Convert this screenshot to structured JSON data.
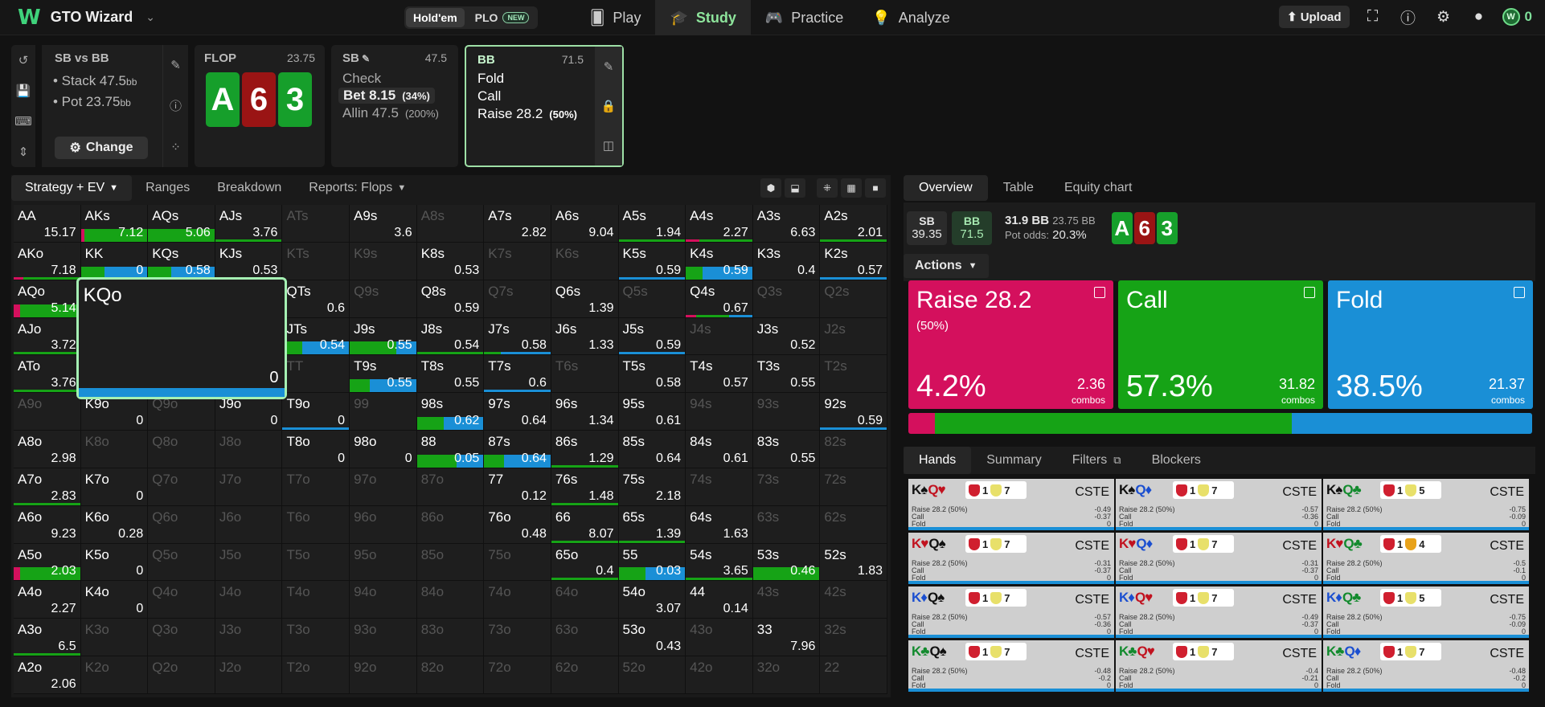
{
  "topbar": {
    "brand_mark": "W",
    "app_title": "GTO Wizard",
    "variants": [
      "Hold'em",
      "PLO"
    ],
    "new_badge": "NEW",
    "nav": [
      {
        "label": "Play",
        "icon": "cards-icon"
      },
      {
        "label": "Study",
        "icon": "graduation-cap-icon"
      },
      {
        "label": "Practice",
        "icon": "gamepad-icon"
      },
      {
        "label": "Analyze",
        "icon": "bulb-icon"
      }
    ],
    "upload_label": "Upload",
    "credits": "0"
  },
  "spot": {
    "title": "SB vs BB",
    "stack_label": "• Stack 47.5",
    "pot_label": "• Pot 23.75",
    "unit": "bb",
    "change_label": "Change"
  },
  "flop": {
    "label": "FLOP",
    "pot": "23.75",
    "cards": [
      {
        "rank": "A",
        "suit": "club"
      },
      {
        "rank": "6",
        "suit": "heart"
      },
      {
        "rank": "3",
        "suit": "club"
      }
    ]
  },
  "sb_node": {
    "label": "SB",
    "stack": "47.5",
    "options": [
      {
        "name": "Check",
        "pct": ""
      },
      {
        "name": "Bet 8.15",
        "pct": "(34%)"
      },
      {
        "name": "Allin 47.5",
        "pct": "(200%)"
      }
    ]
  },
  "bb_node": {
    "label": "BB",
    "stack": "71.5",
    "options": [
      {
        "name": "Fold",
        "pct": ""
      },
      {
        "name": "Call",
        "pct": ""
      },
      {
        "name": "Raise 28.2",
        "pct": "(50%)"
      }
    ]
  },
  "left_tabs": [
    "Strategy + EV",
    "Ranges",
    "Breakdown",
    "Reports: Flops"
  ],
  "colors": {
    "raise": "#d4105d",
    "call": "#16a316",
    "fold": "#1a8fd6"
  },
  "matrix": {
    "ranks": [
      "A",
      "K",
      "Q",
      "J",
      "T",
      "9",
      "8",
      "7",
      "6",
      "5",
      "4",
      "3",
      "2"
    ],
    "selected": {
      "hand": "KQo",
      "ev": "0"
    },
    "cells": {
      "AA": [
        "15.17",
        [
          0,
          0,
          0
        ]
      ],
      "AKs": [
        "7.12",
        [
          0.05,
          0.95,
          0
        ]
      ],
      "AQs": [
        "5.06",
        [
          0,
          1,
          0
        ]
      ],
      "AJs": [
        "3.76",
        [
          0,
          1,
          0
        ]
      ],
      "ATs": [
        null,
        null
      ],
      "A9s": [
        "3.6",
        [
          0,
          0,
          0
        ]
      ],
      "A8s": [
        null,
        null
      ],
      "A7s": [
        "2.82",
        [
          0,
          0,
          0
        ]
      ],
      "A6s": [
        "9.04",
        [
          0,
          0,
          0
        ]
      ],
      "A5s": [
        "1.94",
        [
          0,
          1,
          0
        ]
      ],
      "A4s": [
        "2.27",
        [
          0.2,
          0.8,
          0
        ]
      ],
      "A3s": [
        "6.63",
        [
          0,
          0,
          0
        ]
      ],
      "A2s": [
        "2.01",
        [
          0,
          1,
          0
        ]
      ],
      "AKo": [
        "7.18",
        [
          0.15,
          0.85,
          0
        ]
      ],
      "KK": [
        "0",
        [
          0,
          0.35,
          0.65
        ]
      ],
      "KQs": [
        "0.58",
        [
          0,
          0.35,
          0.65
        ]
      ],
      "KJs": [
        "0.53",
        [
          0,
          0,
          1
        ]
      ],
      "KTs": [
        null,
        null
      ],
      "K9s": [
        null,
        null
      ],
      "K8s": [
        "0.53",
        [
          0,
          0,
          0
        ]
      ],
      "K7s": [
        null,
        null
      ],
      "K6s": [
        null,
        null
      ],
      "K5s": [
        "0.59",
        [
          0,
          0,
          1
        ]
      ],
      "K4s": [
        "0.59",
        [
          0,
          0.25,
          0.75
        ]
      ],
      "K3s": [
        "0.4",
        [
          0,
          0,
          0
        ]
      ],
      "K2s": [
        "0.57",
        [
          0,
          0,
          1
        ]
      ],
      "AQo": [
        "5.14",
        [
          0.1,
          0.9,
          0
        ]
      ],
      "QTs": [
        "0.6",
        [
          0,
          0,
          0
        ]
      ],
      "Q9s": [
        null,
        null
      ],
      "Q8s": [
        "0.59",
        [
          0,
          0,
          0
        ]
      ],
      "Q7s": [
        null,
        null
      ],
      "Q6s": [
        "1.39",
        [
          0,
          0,
          0
        ]
      ],
      "Q5s": [
        null,
        null
      ],
      "Q4s": [
        "0.67",
        [
          0.15,
          0.5,
          0.35
        ]
      ],
      "Q3s": [
        null,
        null
      ],
      "Q2s": [
        null,
        null
      ],
      "AJo": [
        "3.72",
        [
          0,
          1,
          0
        ]
      ],
      "JTs": [
        "0.54",
        [
          0,
          0.3,
          0.7
        ]
      ],
      "J9s": [
        "0.55",
        [
          0,
          0.7,
          0.3
        ]
      ],
      "J8s": [
        "0.54",
        [
          0,
          1,
          0
        ]
      ],
      "J7s": [
        "0.58",
        [
          0,
          0.25,
          0.75
        ]
      ],
      "J6s": [
        "1.33",
        [
          0,
          0,
          0
        ]
      ],
      "J5s": [
        "0.59",
        [
          0,
          0,
          1
        ]
      ],
      "J4s": [
        null,
        null
      ],
      "J3s": [
        "0.52",
        [
          0,
          0,
          0
        ]
      ],
      "J2s": [
        null,
        null
      ],
      "ATo": [
        "3.76",
        [
          0,
          1,
          0
        ]
      ],
      "TT": [
        null,
        null
      ],
      "T9s": [
        "0.55",
        [
          0,
          0.3,
          0.7
        ]
      ],
      "T8s": [
        "0.55",
        [
          0,
          0,
          0
        ]
      ],
      "T7s": [
        "0.6",
        [
          0,
          0,
          1
        ]
      ],
      "T6s": [
        null,
        null
      ],
      "T5s": [
        "0.58",
        [
          0,
          0,
          0
        ]
      ],
      "T4s": [
        "0.57",
        [
          0,
          0,
          0
        ]
      ],
      "T3s": [
        "0.55",
        [
          0,
          0,
          0
        ]
      ],
      "T2s": [
        null,
        null
      ],
      "A9o": [
        null,
        null
      ],
      "K9o": [
        "0",
        [
          0,
          0,
          0
        ]
      ],
      "Q9o": [
        null,
        null
      ],
      "J9o": [
        "0",
        [
          0,
          0,
          0
        ]
      ],
      "T9o": [
        "0",
        [
          0,
          0,
          1
        ]
      ],
      "99": [
        null,
        null
      ],
      "98s": [
        "0.62",
        [
          0,
          0.4,
          0.6
        ]
      ],
      "97s": [
        "0.64",
        [
          0,
          0,
          0
        ]
      ],
      "96s": [
        "1.34",
        [
          0,
          0,
          0
        ]
      ],
      "95s": [
        "0.61",
        [
          0,
          0,
          0
        ]
      ],
      "94s": [
        null,
        null
      ],
      "93s": [
        null,
        null
      ],
      "92s": [
        "0.59",
        [
          0,
          0,
          1
        ]
      ],
      "A8o": [
        "2.98",
        [
          0,
          0,
          0
        ]
      ],
      "K8o": [
        null,
        null
      ],
      "Q8o": [
        null,
        null
      ],
      "J8o": [
        null,
        null
      ],
      "T8o": [
        "0",
        [
          0,
          0,
          0
        ]
      ],
      "98o": [
        "0",
        [
          0,
          0,
          0
        ]
      ],
      "88": [
        "0.05",
        [
          0,
          0.6,
          0.4
        ]
      ],
      "87s": [
        "0.64",
        [
          0,
          0.3,
          0.7
        ]
      ],
      "86s": [
        "1.29",
        [
          0,
          1,
          0
        ]
      ],
      "85s": [
        "0.64",
        [
          0,
          0,
          0
        ]
      ],
      "84s": [
        "0.61",
        [
          0,
          0,
          0
        ]
      ],
      "83s": [
        "0.55",
        [
          0,
          0,
          0
        ]
      ],
      "82s": [
        null,
        null
      ],
      "A7o": [
        "2.83",
        [
          0,
          1,
          0
        ]
      ],
      "K7o": [
        "0",
        [
          0,
          0,
          0
        ]
      ],
      "Q7o": [
        null,
        null
      ],
      "J7o": [
        null,
        null
      ],
      "T7o": [
        null,
        null
      ],
      "97o": [
        null,
        null
      ],
      "87o": [
        null,
        null
      ],
      "77": [
        "0.12",
        [
          0,
          0,
          0
        ]
      ],
      "76s": [
        "1.48",
        [
          0,
          1,
          0
        ]
      ],
      "75s": [
        "2.18",
        [
          0,
          0,
          0
        ]
      ],
      "74s": [
        null,
        null
      ],
      "73s": [
        null,
        null
      ],
      "72s": [
        null,
        null
      ],
      "A6o": [
        "9.23",
        [
          0,
          0,
          0
        ]
      ],
      "K6o": [
        "0.28",
        [
          0,
          0,
          0
        ]
      ],
      "Q6o": [
        null,
        null
      ],
      "J6o": [
        null,
        null
      ],
      "T6o": [
        null,
        null
      ],
      "96o": [
        null,
        null
      ],
      "86o": [
        null,
        null
      ],
      "76o": [
        "0.48",
        [
          0,
          0,
          0
        ]
      ],
      "66": [
        "8.07",
        [
          0,
          1,
          0
        ]
      ],
      "65s": [
        "1.39",
        [
          0,
          1,
          0
        ]
      ],
      "64s": [
        "1.63",
        [
          0,
          0,
          0
        ]
      ],
      "63s": [
        null,
        null
      ],
      "62s": [
        null,
        null
      ],
      "A5o": [
        "2.03",
        [
          0.1,
          0.9,
          0
        ]
      ],
      "K5o": [
        "0",
        [
          0,
          0,
          0
        ]
      ],
      "Q5o": [
        null,
        null
      ],
      "J5o": [
        null,
        null
      ],
      "T5o": [
        null,
        null
      ],
      "95o": [
        null,
        null
      ],
      "85o": [
        null,
        null
      ],
      "75o": [
        null,
        null
      ],
      "65o": [
        "0.4",
        [
          0,
          1,
          0
        ]
      ],
      "55": [
        "0.03",
        [
          0,
          0.4,
          0.6
        ]
      ],
      "54s": [
        "3.65",
        [
          0,
          1,
          0
        ]
      ],
      "53s": [
        "0.46",
        [
          0,
          1,
          0
        ]
      ],
      "52s": [
        "1.83",
        [
          0,
          0,
          0
        ]
      ],
      "A4o": [
        "2.27",
        [
          0,
          0,
          0
        ]
      ],
      "K4o": [
        "0",
        [
          0,
          0,
          0
        ]
      ],
      "Q4o": [
        null,
        null
      ],
      "J4o": [
        null,
        null
      ],
      "T4o": [
        null,
        null
      ],
      "94o": [
        null,
        null
      ],
      "84o": [
        null,
        null
      ],
      "74o": [
        null,
        null
      ],
      "64o": [
        null,
        null
      ],
      "54o": [
        "3.07",
        [
          0,
          0,
          0
        ]
      ],
      "44": [
        "0.14",
        [
          0,
          0,
          0
        ]
      ],
      "43s": [
        null,
        null
      ],
      "42s": [
        null,
        null
      ],
      "A3o": [
        "6.5",
        [
          0,
          1,
          0
        ]
      ],
      "K3o": [
        null,
        null
      ],
      "Q3o": [
        null,
        null
      ],
      "J3o": [
        null,
        null
      ],
      "T3o": [
        null,
        null
      ],
      "93o": [
        null,
        null
      ],
      "83o": [
        null,
        null
      ],
      "73o": [
        null,
        null
      ],
      "63o": [
        null,
        null
      ],
      "53o": [
        "0.43",
        [
          0,
          0,
          0
        ]
      ],
      "43o": [
        null,
        null
      ],
      "33": [
        "7.96",
        [
          0,
          0,
          0
        ]
      ],
      "32s": [
        null,
        null
      ],
      "A2o": [
        "2.06",
        [
          0,
          0,
          0
        ]
      ],
      "K2o": [
        null,
        null
      ],
      "Q2o": [
        null,
        null
      ],
      "J2o": [
        null,
        null
      ],
      "T2o": [
        null,
        null
      ],
      "92o": [
        null,
        null
      ],
      "82o": [
        null,
        null
      ],
      "72o": [
        null,
        null
      ],
      "62o": [
        null,
        null
      ],
      "52o": [
        null,
        null
      ],
      "42o": [
        null,
        null
      ],
      "32o": [
        null,
        null
      ],
      "22": [
        null,
        null
      ]
    }
  },
  "right_tabs": [
    "Overview",
    "Table",
    "Equity chart"
  ],
  "info": {
    "sb_label": "SB",
    "sb_stack": "39.35",
    "bb_label": "BB",
    "bb_stack": "71.5",
    "pot_a": "31.9 BB",
    "pot_b": "23.75 BB",
    "odds_label": "Pot odds:",
    "odds_value": "20.3%"
  },
  "actions_label": "Actions",
  "action_cards": [
    {
      "name": "Raise 28.2",
      "sub": "(50%)",
      "pct": "4.2%",
      "combos": "2.36",
      "combos_label": "combos",
      "freq": 0.042,
      "color": "#d4105d"
    },
    {
      "name": "Call",
      "sub": "",
      "pct": "57.3%",
      "combos": "31.82",
      "combos_label": "combos",
      "freq": 0.573,
      "color": "#16a316"
    },
    {
      "name": "Fold",
      "sub": "",
      "pct": "38.5%",
      "combos": "21.37",
      "combos_label": "combos",
      "freq": 0.385,
      "color": "#1a8fd6"
    }
  ],
  "hand_tabs": [
    "Hands",
    "Summary",
    "Filters",
    "Blockers"
  ],
  "hands": [
    {
      "c": [
        [
          "K",
          "♠",
          "blk"
        ],
        [
          "Q",
          "♥",
          "red"
        ]
      ],
      "n": "7",
      "cs": "CSTE",
      "r": [
        "-0.49",
        "-0.37",
        "0"
      ]
    },
    {
      "c": [
        [
          "K",
          "♠",
          "blk"
        ],
        [
          "Q",
          "♦",
          "blu"
        ]
      ],
      "n": "7",
      "cs": "CSTE",
      "r": [
        "-0.57",
        "-0.36",
        "0"
      ]
    },
    {
      "c": [
        [
          "K",
          "♠",
          "blk"
        ],
        [
          "Q",
          "♣",
          "grn"
        ]
      ],
      "n": "5",
      "cs": "CSTE",
      "r": [
        "-0.75",
        "-0.09",
        "0"
      ]
    },
    {
      "c": [
        [
          "K",
          "♥",
          "red"
        ],
        [
          "Q",
          "♠",
          "blk"
        ]
      ],
      "n": "7",
      "cs": "CSTE",
      "r": [
        "-0.31",
        "-0.37",
        "0"
      ]
    },
    {
      "c": [
        [
          "K",
          "♥",
          "red"
        ],
        [
          "Q",
          "♦",
          "blu"
        ]
      ],
      "n": "7",
      "cs": "CSTE",
      "r": [
        "-0.31",
        "-0.37",
        "0"
      ]
    },
    {
      "c": [
        [
          "K",
          "♥",
          "red"
        ],
        [
          "Q",
          "♣",
          "grn"
        ]
      ],
      "n": "4",
      "cs": "CSTE",
      "r": [
        "-0.5",
        "-0.1",
        "0"
      ]
    },
    {
      "c": [
        [
          "K",
          "♦",
          "blu"
        ],
        [
          "Q",
          "♠",
          "blk"
        ]
      ],
      "n": "7",
      "cs": "CSTE",
      "r": [
        "-0.57",
        "-0.36",
        "0"
      ]
    },
    {
      "c": [
        [
          "K",
          "♦",
          "blu"
        ],
        [
          "Q",
          "♥",
          "red"
        ]
      ],
      "n": "7",
      "cs": "CSTE",
      "r": [
        "-0.49",
        "-0.37",
        "0"
      ]
    },
    {
      "c": [
        [
          "K",
          "♦",
          "blu"
        ],
        [
          "Q",
          "♣",
          "grn"
        ]
      ],
      "n": "5",
      "cs": "CSTE",
      "r": [
        "-0.75",
        "-0.09",
        "0"
      ]
    },
    {
      "c": [
        [
          "K",
          "♣",
          "grn"
        ],
        [
          "Q",
          "♠",
          "blk"
        ]
      ],
      "n": "7",
      "cs": "CSTE",
      "r": [
        "-0.48",
        "-0.2",
        "0"
      ]
    },
    {
      "c": [
        [
          "K",
          "♣",
          "grn"
        ],
        [
          "Q",
          "♥",
          "red"
        ]
      ],
      "n": "7",
      "cs": "CSTE",
      "r": [
        "-0.4",
        "-0.21",
        "0"
      ]
    },
    {
      "c": [
        [
          "K",
          "♣",
          "grn"
        ],
        [
          "Q",
          "♦",
          "blu"
        ]
      ],
      "n": "7",
      "cs": "CSTE",
      "r": [
        "-0.48",
        "-0.2",
        "0"
      ]
    }
  ],
  "hand_row_labels": [
    "Raise 28.2",
    "Call",
    "Fold"
  ],
  "hand_row_pct": "(50%)"
}
